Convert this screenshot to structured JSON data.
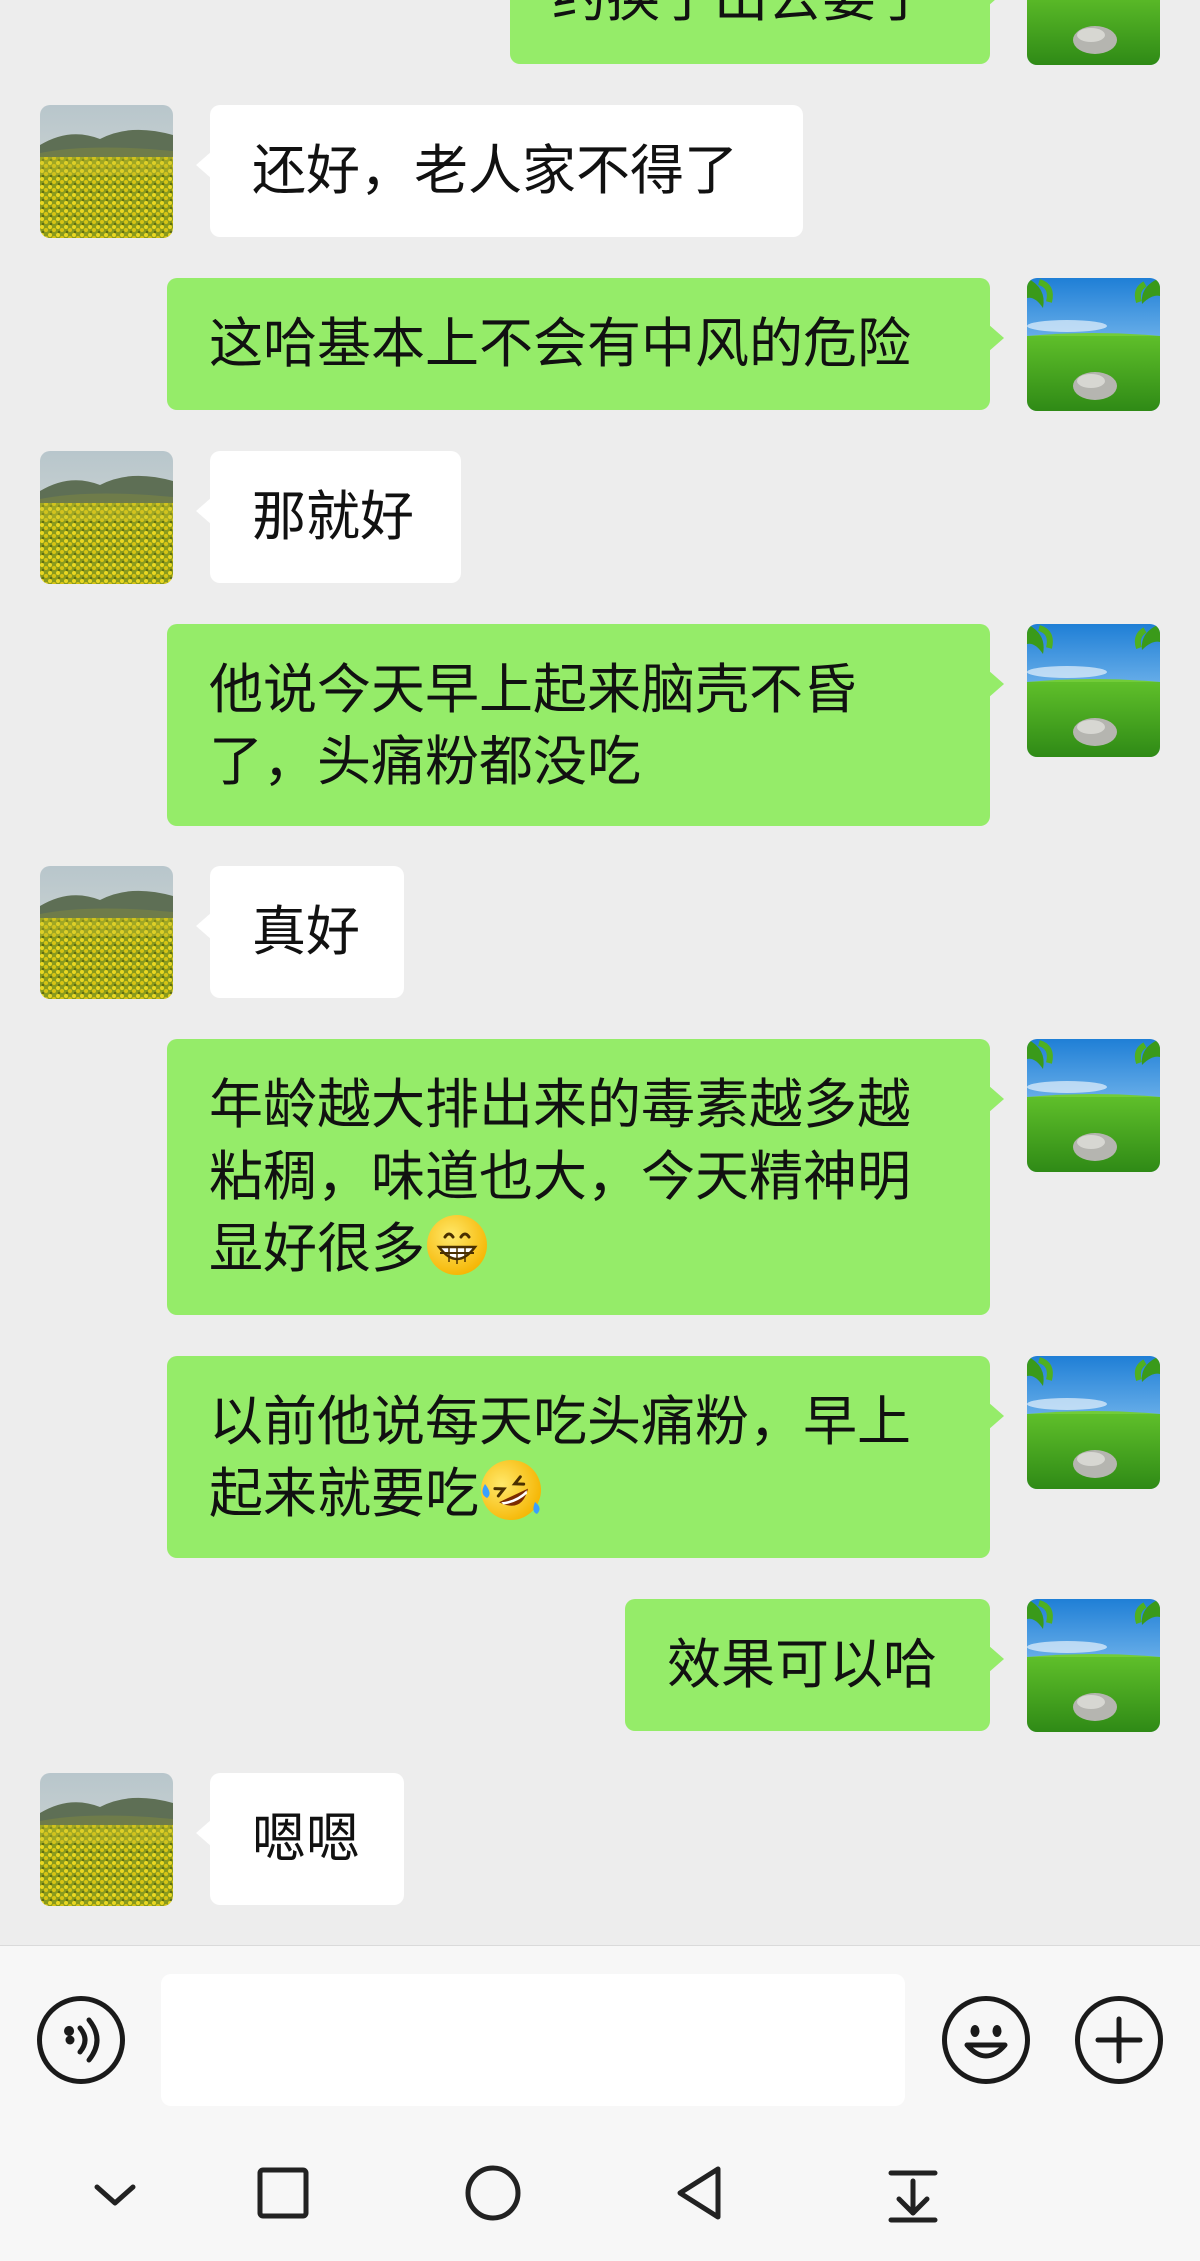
{
  "chat": {
    "messages": [
      {
        "side": "right",
        "text": "约换了出去耍了"
      },
      {
        "side": "left",
        "text": "还好，老人家不得了"
      },
      {
        "side": "right",
        "text": "这哈基本上不会有中风的危险"
      },
      {
        "side": "left",
        "text": "那就好"
      },
      {
        "side": "right",
        "text": "他说今天早上起来脑壳不昏了，头痛粉都没吃"
      },
      {
        "side": "left",
        "text": "真好"
      },
      {
        "side": "right",
        "text": "年龄越大排出来的毒素越多越粘稠，味道也大，今天精神明显好很多",
        "emoji": "grinning-face"
      },
      {
        "side": "right",
        "text": "以前他说每天吃头痛粉，早上起来就要吃",
        "emoji": "rolling-laughing-face"
      },
      {
        "side": "right",
        "text": "效果可以哈"
      },
      {
        "side": "left",
        "text": "嗯嗯"
      }
    ]
  },
  "input_bar": {
    "voice_icon": "voice-icon",
    "input_value": "",
    "emoji_icon": "emoji-icon",
    "plus_icon": "plus-icon"
  },
  "nav_bar": {
    "icons": [
      "chevron-down-icon",
      "square-icon",
      "circle-icon",
      "back-triangle-icon",
      "pull-down-icon"
    ]
  },
  "colors": {
    "background": "#ededed",
    "self_bubble": "#95ec69",
    "other_bubble": "#ffffff",
    "bar": "#f7f7f7"
  }
}
